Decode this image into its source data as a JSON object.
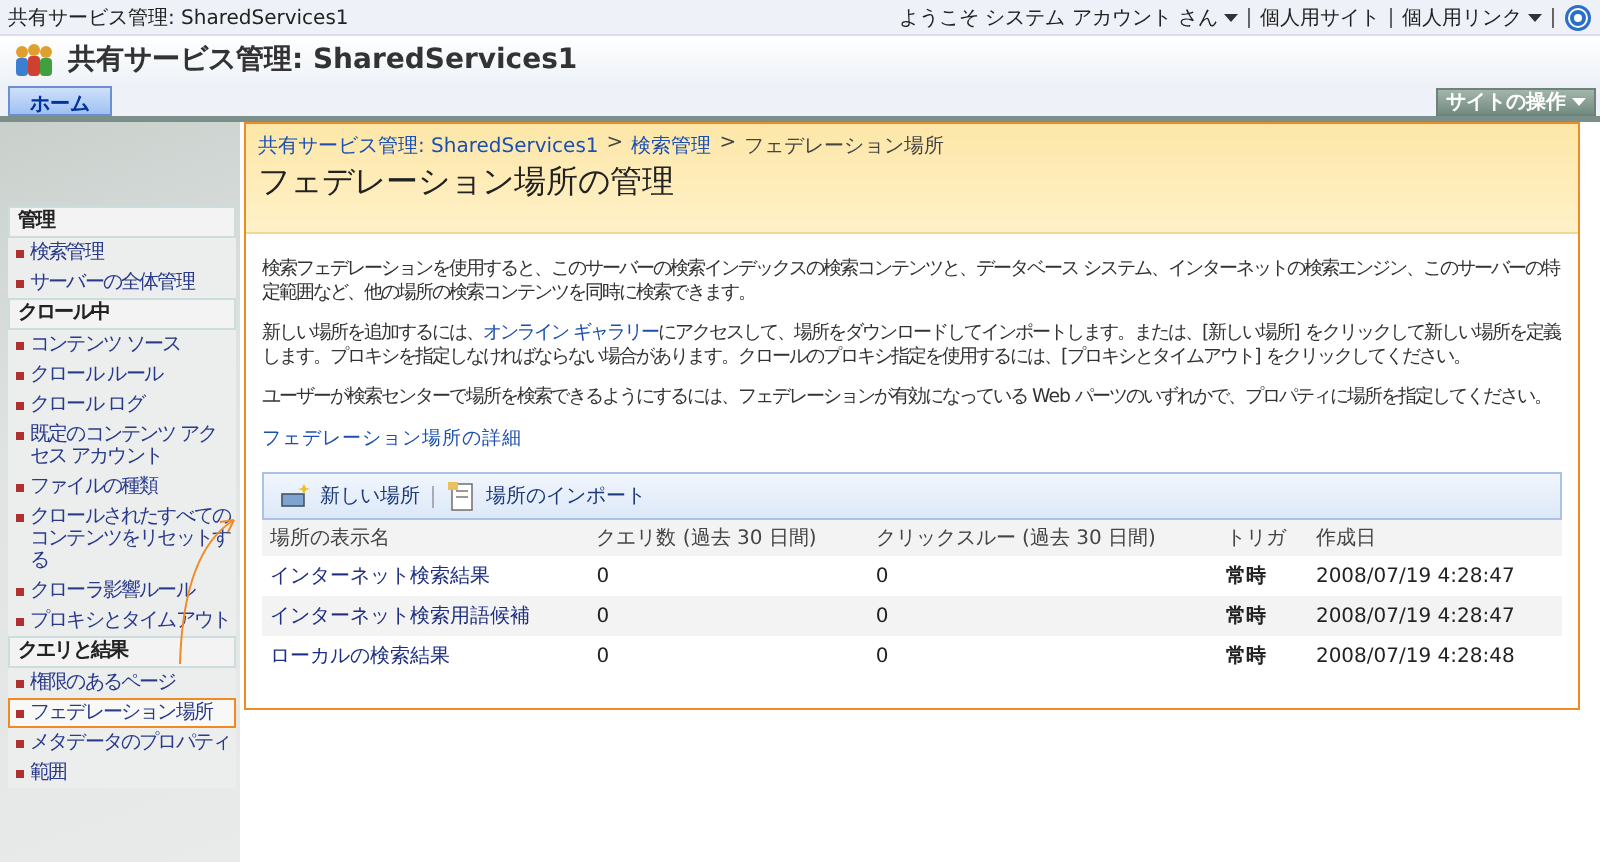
{
  "top_bar": {
    "site_title": "共有サービス管理: SharedServices1",
    "links": [
      {
        "label": "ようこそ システム アカウント さん",
        "dropdown": true
      },
      {
        "label": "個人用サイト",
        "dropdown": false
      },
      {
        "label": "個人用リンク",
        "dropdown": true
      }
    ]
  },
  "header": {
    "title": "共有サービス管理: SharedServices1"
  },
  "tabs": [
    {
      "label": "ホーム",
      "selected": true
    }
  ],
  "site_actions": {
    "label": "サイトの操作"
  },
  "sidebar": {
    "sections": [
      {
        "title": "管理",
        "items": [
          {
            "label": "検索管理",
            "selected": false
          },
          {
            "label": "サーバーの全体管理",
            "selected": false
          }
        ]
      },
      {
        "title": "クロール中",
        "items": [
          {
            "label": "コンテンツ ソース",
            "selected": false
          },
          {
            "label": "クロール ルール",
            "selected": false
          },
          {
            "label": "クロール ログ",
            "selected": false
          },
          {
            "label": "既定のコンテンツ アクセス アカウント",
            "selected": false
          },
          {
            "label": "ファイルの種類",
            "selected": false
          },
          {
            "label": "クロールされたすべてのコンテンツをリセットする",
            "selected": false
          },
          {
            "label": "クローラ影響ルール",
            "selected": false
          },
          {
            "label": "プロキシとタイムアウト",
            "selected": false
          }
        ]
      },
      {
        "title": "クエリと結果",
        "items": [
          {
            "label": "権限のあるページ",
            "selected": false
          },
          {
            "label": "フェデレーション場所",
            "selected": true
          },
          {
            "label": "メタデータのプロパティ",
            "selected": false
          },
          {
            "label": "範囲",
            "selected": false
          }
        ]
      }
    ]
  },
  "breadcrumb": {
    "links": [
      "共有サービス管理: SharedServices1",
      "検索管理"
    ],
    "separator": ">",
    "current": "フェデレーション場所"
  },
  "page_title": "フェデレーション場所の管理",
  "paragraphs": [
    {
      "parts": [
        {
          "text": "検索フェデレーションを使用すると、このサーバーの検索インデックスの検索コンテンツと、データベース システム、インターネットの検索エンジン、このサーバーの特定範囲など、他の場所の検索コンテンツを同時に検索できます。",
          "link": false
        }
      ]
    },
    {
      "parts": [
        {
          "text": "新しい場所を追加するには、",
          "link": false
        },
        {
          "text": "オンライン ギャラリー",
          "link": true
        },
        {
          "text": "にアクセスして、場所をダウンロードしてインポートします。または、[新しい場所] をクリックして新しい場所を定義します。プロキシを指定しなければならない場合があります。クロールのプロキシ指定を使用するには、[プロキシとタイムアウト] をクリックしてください。",
          "link": false
        }
      ]
    },
    {
      "parts": [
        {
          "text": "ユーザーが検索センターで場所を検索できるようにするには、フェデレーションが有効になっている Web パーツのいずれかで、プロパティに場所を指定してください。",
          "link": false
        }
      ]
    }
  ],
  "details_link": "フェデレーション場所の詳細",
  "toolbar": [
    {
      "label": "新しい場所",
      "kind": "new"
    },
    {
      "label": "場所のインポート",
      "kind": "import"
    }
  ],
  "table": {
    "columns": [
      "場所の表示名",
      "クエリ数 (過去 30 日間)",
      "クリックスルー (過去 30 日間)",
      "トリガ",
      "作成日"
    ],
    "rows": [
      [
        "インターネット検索結果",
        "0",
        "0",
        "常時",
        "2008/07/19 4:28:47"
      ],
      [
        "インターネット検索用語候補",
        "0",
        "0",
        "常時",
        "2008/07/19 4:28:47"
      ],
      [
        "ローカルの検索結果",
        "0",
        "0",
        "常時",
        "2008/07/19 4:28:48"
      ]
    ]
  }
}
